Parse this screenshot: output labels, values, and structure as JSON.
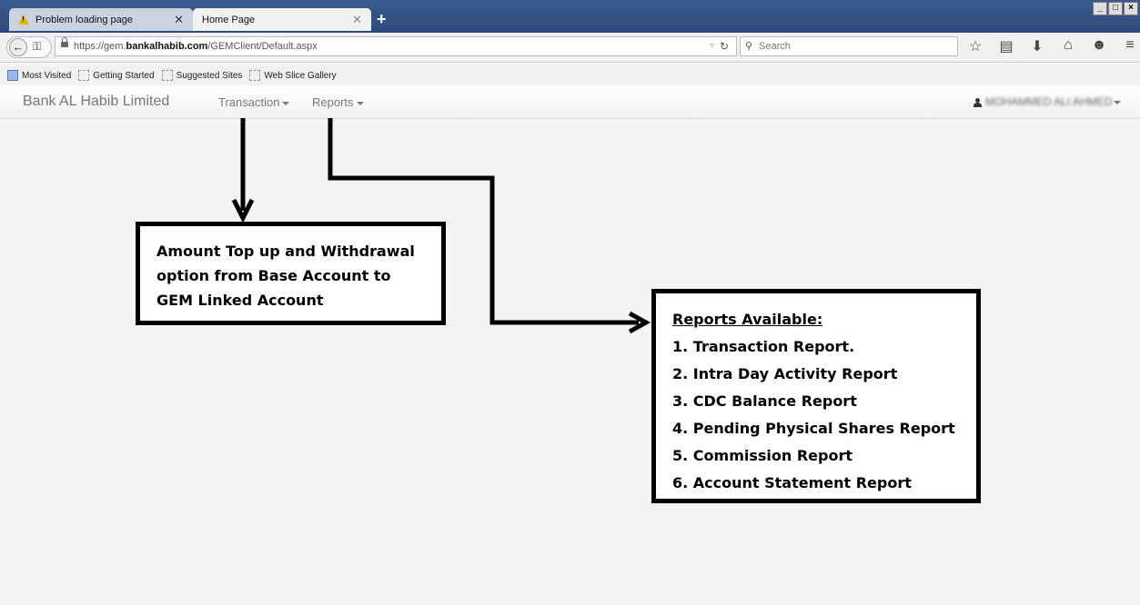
{
  "browser": {
    "tabs": [
      {
        "label": "Problem loading page",
        "icon": "warning-icon",
        "active": false
      },
      {
        "label": "Home Page",
        "active": true
      }
    ],
    "new_tab_label": "+",
    "window_buttons": [
      "_",
      "□",
      "×"
    ],
    "url": {
      "prefix": "https://gem.",
      "domain": "bankalhabib.com",
      "path": "/GEMClient/Default.aspx"
    },
    "search_placeholder": "Search",
    "toolbar_icons": [
      "star-icon",
      "reading-list-icon",
      "download-icon",
      "home-icon",
      "chat-icon",
      "hamburger-menu-icon"
    ],
    "bookmarks": [
      "Most Visited",
      "Getting Started",
      "Suggested Sites",
      "Web Slice Gallery"
    ]
  },
  "app": {
    "brand": "Bank AL Habib Limited",
    "menus": [
      "Transaction",
      "Reports"
    ],
    "user": "MOHAMMED ALI AHMED"
  },
  "annotations": {
    "transaction": [
      "Amount Top up and Withdrawal",
      "option from Base Account to",
      "GEM Linked Account"
    ],
    "reports_title": "Reports Available:",
    "reports": [
      "1. Transaction Report.",
      "2. Intra Day Activity Report",
      "3. CDC Balance Report",
      "4. Pending Physical Shares Report",
      "5. Commission Report",
      "6. Account Statement Report"
    ]
  }
}
